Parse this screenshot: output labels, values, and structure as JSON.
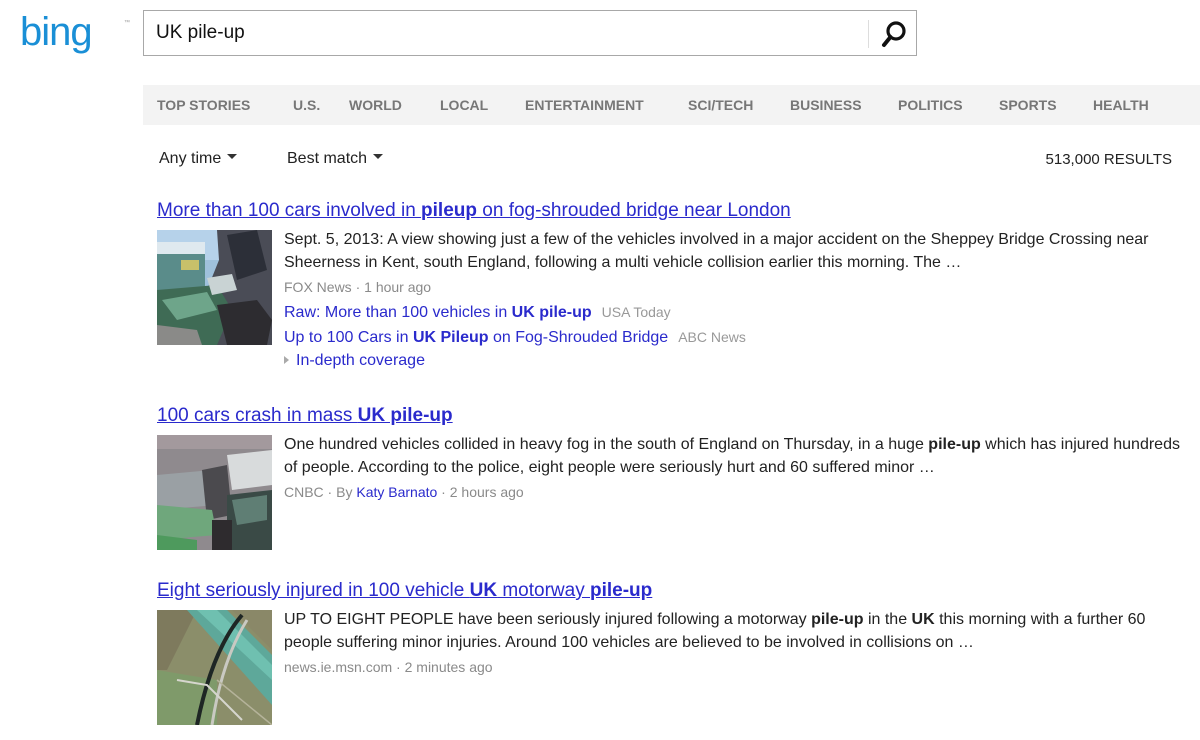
{
  "logo": {
    "text": "bing",
    "tm": "™"
  },
  "search": {
    "query": "UK pile-up",
    "button_icon": "search-icon"
  },
  "nav": {
    "items": [
      {
        "label": "TOP STORIES"
      },
      {
        "label": "U.S."
      },
      {
        "label": "WORLD"
      },
      {
        "label": "LOCAL"
      },
      {
        "label": "ENTERTAINMENT"
      },
      {
        "label": "SCI/TECH"
      },
      {
        "label": "BUSINESS"
      },
      {
        "label": "POLITICS"
      },
      {
        "label": "SPORTS"
      },
      {
        "label": "HEALTH"
      }
    ]
  },
  "filters": {
    "time": "Any time",
    "sort": "Best match"
  },
  "result_count": "513,000 RESULTS",
  "colors": {
    "link": "#2a2acc",
    "meta": "#8a8a8a",
    "nav_bg": "#f3f3f3",
    "logo": "#1a8fd6"
  },
  "results": [
    {
      "title": [
        {
          "t": "More than 100 cars involved in ",
          "b": false
        },
        {
          "t": "pileup",
          "b": true
        },
        {
          "t": " on fog-shrouded bridge near London",
          "b": false
        }
      ],
      "snippet": [
        {
          "t": "Sept. 5, 2013: A view showing just a few of the vehicles involved in a major accident on the Sheppey Bridge Crossing near Sheerness in Kent, south England, following a multi vehicle collision earlier this morning. The …",
          "b": false
        }
      ],
      "source": "FOX News",
      "time": "1 hour ago",
      "related": [
        {
          "parts": [
            {
              "t": "Raw: More than 100 vehicles in ",
              "b": false
            },
            {
              "t": "UK pile-up",
              "b": true
            }
          ],
          "source": "USA Today"
        },
        {
          "parts": [
            {
              "t": "Up to 100 Cars in ",
              "b": false
            },
            {
              "t": "UK Pileup",
              "b": true
            },
            {
              "t": " on Fog-Shrouded Bridge",
              "b": false
            }
          ],
          "source": "ABC News"
        }
      ],
      "indepth": "In-depth coverage"
    },
    {
      "title": [
        {
          "t": "100 cars crash in mass ",
          "b": false
        },
        {
          "t": "UK pile-up",
          "b": true
        }
      ],
      "snippet": [
        {
          "t": "One hundred vehicles collided in heavy fog in the south of England on Thursday, in a huge ",
          "b": false
        },
        {
          "t": "pile-up",
          "b": true
        },
        {
          "t": " which has injured hundreds of people. According to the police, eight people were seriously hurt and 60 suffered minor …",
          "b": false
        }
      ],
      "source": "CNBC",
      "byline_prefix": "By",
      "author": "Katy Barnato",
      "time": "2 hours ago"
    },
    {
      "title": [
        {
          "t": "Eight seriously injured in 100 vehicle ",
          "b": false
        },
        {
          "t": "UK",
          "b": true
        },
        {
          "t": " motorway ",
          "b": false
        },
        {
          "t": "pile-up",
          "b": true
        }
      ],
      "snippet": [
        {
          "t": "UP TO EIGHT PEOPLE have been seriously injured following a motorway ",
          "b": false
        },
        {
          "t": "pile-up",
          "b": true
        },
        {
          "t": " in the ",
          "b": false
        },
        {
          "t": "UK",
          "b": true
        },
        {
          "t": " this morning with a further 60 people suffering minor injuries. Around 100 vehicles are believed to be involved in collisions on …",
          "b": false
        }
      ],
      "source": "news.ie.msn.com",
      "time": "2 minutes ago"
    }
  ]
}
